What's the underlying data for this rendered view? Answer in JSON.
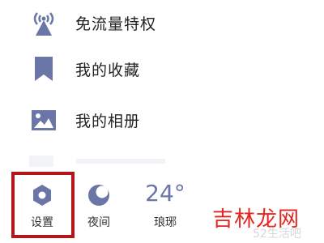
{
  "menu": {
    "items": [
      {
        "label": "免流量特权",
        "icon": "broadcast-tower-icon"
      },
      {
        "label": "我的收藏",
        "icon": "bookmark-icon"
      },
      {
        "label": "我的相册",
        "icon": "picture-icon"
      }
    ]
  },
  "toolbar": {
    "settings_label": "设置",
    "settings_icon": "gear-hexagon-icon",
    "night_label": "夜间",
    "night_icon": "moon-icon",
    "weather_value": "24°",
    "weather_label": "琅琊"
  },
  "highlight": {
    "target": "settings",
    "color": "#b5161c"
  },
  "watermark": {
    "main": "吉林龙网",
    "sub": "52生活吧"
  },
  "colors": {
    "icon": "#6b76a8",
    "text": "#222222",
    "watermark": "#e6241d"
  }
}
